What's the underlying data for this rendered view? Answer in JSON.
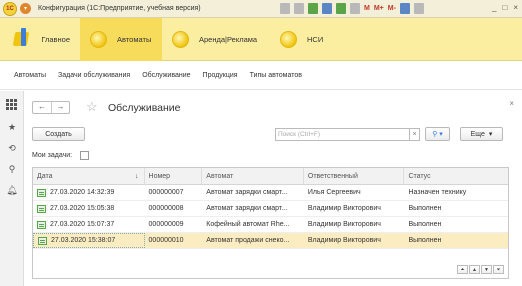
{
  "titlebar": {
    "logo": "1С",
    "title": "Конфигурация (1С:Предприятие, учебная версия)",
    "m": "M",
    "mplus": "M+",
    "mminus": "M-"
  },
  "sections": [
    {
      "label": "Главное",
      "icon": "home-icon"
    },
    {
      "label": "Автоматы",
      "icon": "section-icon"
    },
    {
      "label": "Аренда|Реклама",
      "icon": "section-icon"
    },
    {
      "label": "НСИ",
      "icon": "section-icon"
    }
  ],
  "navlinks": [
    "Автоматы",
    "Задачи обслуживания",
    "Обслуживание",
    "Продукция",
    "Типы автоматов"
  ],
  "form": {
    "title": "Обслуживание",
    "create_label": "Создать",
    "search_placeholder": "Поиск (Ctrl+F)",
    "more_label": "Еще",
    "my_tasks_label": "Мои задачи:"
  },
  "table": {
    "columns": [
      "Дата",
      "Номер",
      "Автомат",
      "Ответственный",
      "Статус"
    ],
    "rows": [
      {
        "date": "27.03.2020 14:32:39",
        "number": "000000007",
        "machine": "Автомат зарядки смарт...",
        "responsible": "Илья Сергеевич",
        "status": "Назначен технику"
      },
      {
        "date": "27.03.2020 15:05:38",
        "number": "000000008",
        "machine": "Автомат зарядки смарт...",
        "responsible": "Владимир Викторович",
        "status": "Выполнен"
      },
      {
        "date": "27.03.2020 15:07:37",
        "number": "000000009",
        "machine": "Кофейный автомат Rhe...",
        "responsible": "Владимир Викторович",
        "status": "Выполнен"
      },
      {
        "date": "27.03.2020 15:38:07",
        "number": "000000010",
        "machine": "Автомат продажи снеко...",
        "responsible": "Владимир Викторович",
        "status": "Выполнен"
      }
    ],
    "selected_row": 3
  }
}
